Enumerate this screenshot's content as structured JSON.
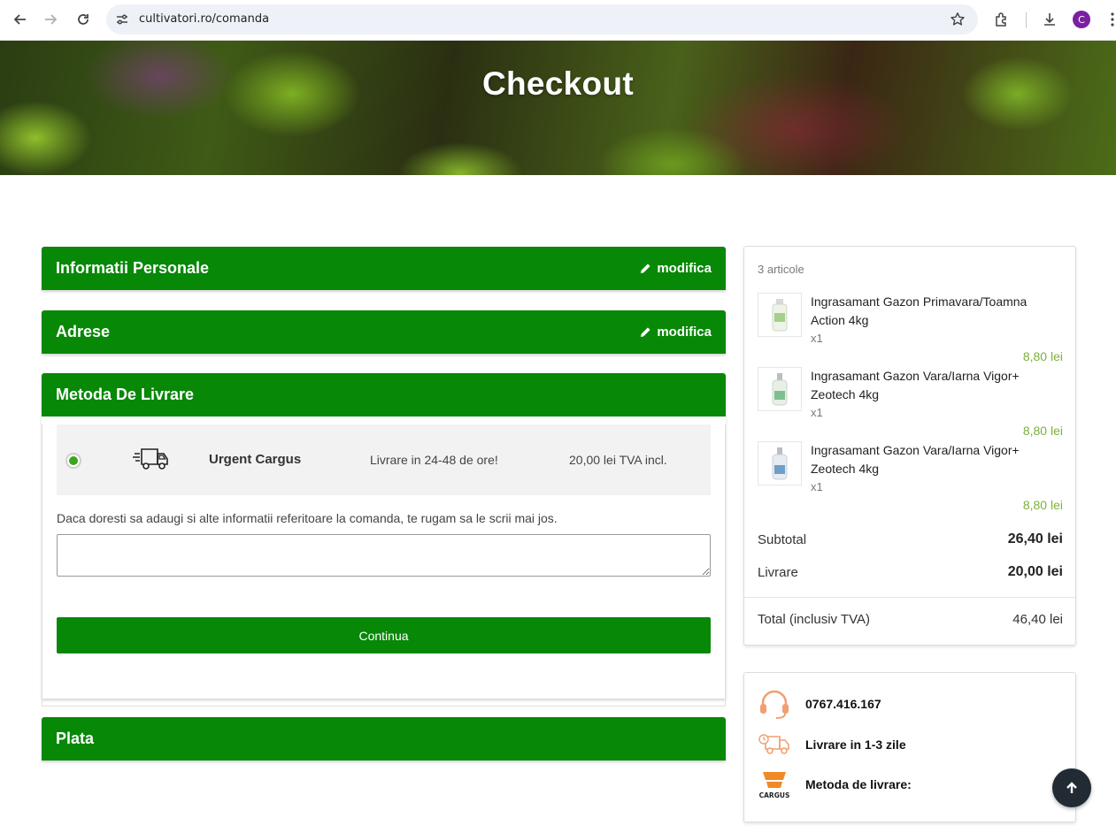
{
  "browser": {
    "url": "cultivatori.ro/comanda",
    "profile_initial": "C"
  },
  "hero": {
    "title": "Checkout"
  },
  "steps": {
    "personal": {
      "title": "Informatii Personale",
      "edit_label": "modifica"
    },
    "addresses": {
      "title": "Adrese",
      "edit_label": "modifica"
    },
    "delivery": {
      "title": "Metoda De Livrare",
      "carrier": {
        "name": "Urgent Cargus",
        "delay": "Livrare in 24-48 de ore!",
        "price": "20,00 lei TVA incl.",
        "selected": true
      },
      "notes_label": "Daca doresti sa adaugi si alte informatii referitoare la comanda, te rugam sa le scrii mai jos.",
      "notes_value": "",
      "continue_label": "Continua"
    },
    "payment": {
      "title": "Plata"
    }
  },
  "summary": {
    "items_count": "3 articole",
    "items": [
      {
        "name": "Ingrasamant Gazon Primavara/Toamna Action 4kg",
        "qty": "x1",
        "price": "8,80 lei"
      },
      {
        "name": "Ingrasamant Gazon Vara/Iarna Vigor+ Zeotech 4kg",
        "qty": "x1",
        "price": "8,80 lei"
      },
      {
        "name": "Ingrasamant Gazon Vara/Iarna Vigor+ Zeotech 4kg",
        "qty": "x1",
        "price": "8,80 lei"
      }
    ],
    "subtotal_label": "Subtotal",
    "subtotal_value": "26,40 lei",
    "shipping_label": "Livrare",
    "shipping_value": "20,00 lei",
    "total_label": "Total (inclusiv TVA)",
    "total_value": "46,40 lei"
  },
  "reassurance": {
    "phone": "0767.416.167",
    "delivery": "Livrare in 1-3 zile",
    "method": "Metoda de livrare:",
    "cargus_logo_text": "CARGUS"
  },
  "colors": {
    "brand_green": "#078807",
    "price_green": "#7bb13a",
    "icon_orange": "#f0a070",
    "dark_button": "#222b33"
  }
}
